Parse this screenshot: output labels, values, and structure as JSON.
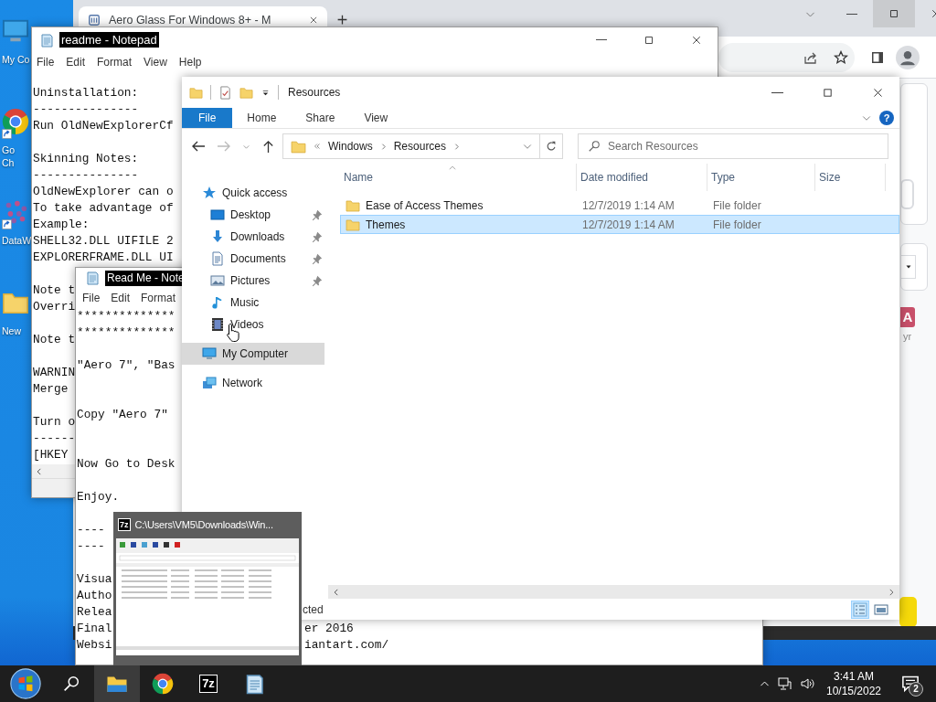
{
  "desktop": {
    "icons": [
      {
        "kind": "computer",
        "label": [
          "My Co"
        ],
        "shortcut": false
      },
      {
        "kind": "chrome",
        "label": [
          "Go",
          "Ch"
        ],
        "shortcut": true
      },
      {
        "kind": "dots",
        "label": [
          "DataW"
        ],
        "shortcut": true
      },
      {
        "kind": "folder",
        "label": [
          "New"
        ],
        "shortcut": false
      }
    ]
  },
  "browser": {
    "tab_title": "Aero Glass For Windows 8+ - M",
    "badge": "A",
    "badge_caption": "yr"
  },
  "readme_notepad": {
    "title": "readme - Notepad",
    "menu": [
      "File",
      "Edit",
      "Format",
      "View",
      "Help"
    ],
    "lines": [
      {
        "text": "Uninstallation:"
      },
      {
        "text": "---------------"
      },
      {
        "text": "Run OldNewExplorerCf"
      },
      {
        "text": "Skinning Notes:",
        "gap_before": true
      },
      {
        "text": "---------------"
      },
      {
        "text": "OldNewExplorer can o"
      },
      {
        "text": "To take advantage of"
      },
      {
        "text": "Example:"
      },
      {
        "text": "SHELL32.DLL UIFILE 2"
      },
      {
        "text": "EXPLORERFRAME.DLL UI"
      },
      {
        "text": "Note t",
        "gap_before": true
      },
      {
        "text": "Overri"
      },
      {
        "text": "Note t",
        "gap_before": true
      },
      {
        "text": "WARNIN",
        "gap_before": true
      },
      {
        "text": "Merge"
      },
      {
        "text": "Turn o",
        "gap_before": true
      },
      {
        "text": "------"
      },
      {
        "text": "[HKEY"
      }
    ]
  },
  "readme_front": {
    "title": "Read Me - Note",
    "menu": [
      "File",
      "Edit",
      "Format"
    ],
    "lines": [
      {
        "text": "**************"
      },
      {
        "text": "**************"
      },
      {
        "text": "\"Aero 7\", \"Bas",
        "gap_before": true
      },
      {
        "text": "Copy \"Aero 7\"",
        "double_gap_before": true
      },
      {
        "text": "Now Go to Desk",
        "double_gap_before": true
      },
      {
        "text": "Enjoy.",
        "gap_before": true
      },
      {
        "text": "----",
        "gap_before": true
      },
      {
        "text": "----"
      },
      {
        "text": "Visua",
        "gap_before": true
      },
      {
        "text": "Autho"
      },
      {
        "text": "Relea"
      },
      {
        "text": "Final",
        "tail": "er 2016"
      },
      {
        "text": "Websi",
        "tail": "iantart.com/"
      }
    ]
  },
  "explorer": {
    "title": "Resources",
    "ribbon_tabs": [
      {
        "label": "File",
        "selected": true
      },
      {
        "label": "Home",
        "selected": false
      },
      {
        "label": "Share",
        "selected": false
      },
      {
        "label": "View",
        "selected": false
      }
    ],
    "help": "?",
    "breadcrumb": [
      "Windows",
      "Resources"
    ],
    "search": {
      "placeholder": "Search Resources"
    },
    "nav": [
      {
        "label": "Quick access",
        "selected": false,
        "children": [
          {
            "label": "Desktop",
            "pinned": true,
            "selected": false
          },
          {
            "label": "Downloads",
            "pinned": true,
            "selected": false
          },
          {
            "label": "Documents",
            "pinned": true,
            "selected": false
          },
          {
            "label": "Pictures",
            "pinned": true,
            "selected": false
          },
          {
            "label": "Music",
            "pinned": false,
            "selected": false
          },
          {
            "label": "Videos",
            "pinned": false,
            "selected": false
          }
        ]
      },
      {
        "label": "My Computer",
        "selected": true
      },
      {
        "label": "Network",
        "selected": false
      }
    ],
    "columns": [
      "Name",
      "Date modified",
      "Type",
      "Size"
    ],
    "rows": [
      {
        "name": "Ease of Access Themes",
        "date": "12/7/2019 1:14 AM",
        "type": "File folder",
        "selected": false
      },
      {
        "name": "Themes",
        "date": "12/7/2019 1:14 AM",
        "type": "File folder",
        "selected": true
      }
    ],
    "status": "cted",
    "views": [
      {
        "kind": "details",
        "selected": true
      },
      {
        "kind": "tiles",
        "selected": false
      }
    ]
  },
  "thumbnail": {
    "logo": "7z",
    "title": "C:\\Users\\VM5\\Downloads\\Win..."
  },
  "taskbar": {
    "apps": [
      {
        "kind": "explorer",
        "selected": true
      },
      {
        "kind": "chrome",
        "selected": false
      },
      {
        "kind": "sevenzip",
        "logo": "7z",
        "selected": false
      },
      {
        "kind": "notepad",
        "selected": false
      }
    ],
    "time": "3:41 AM",
    "date": "10/15/2022",
    "notifications": "2"
  }
}
